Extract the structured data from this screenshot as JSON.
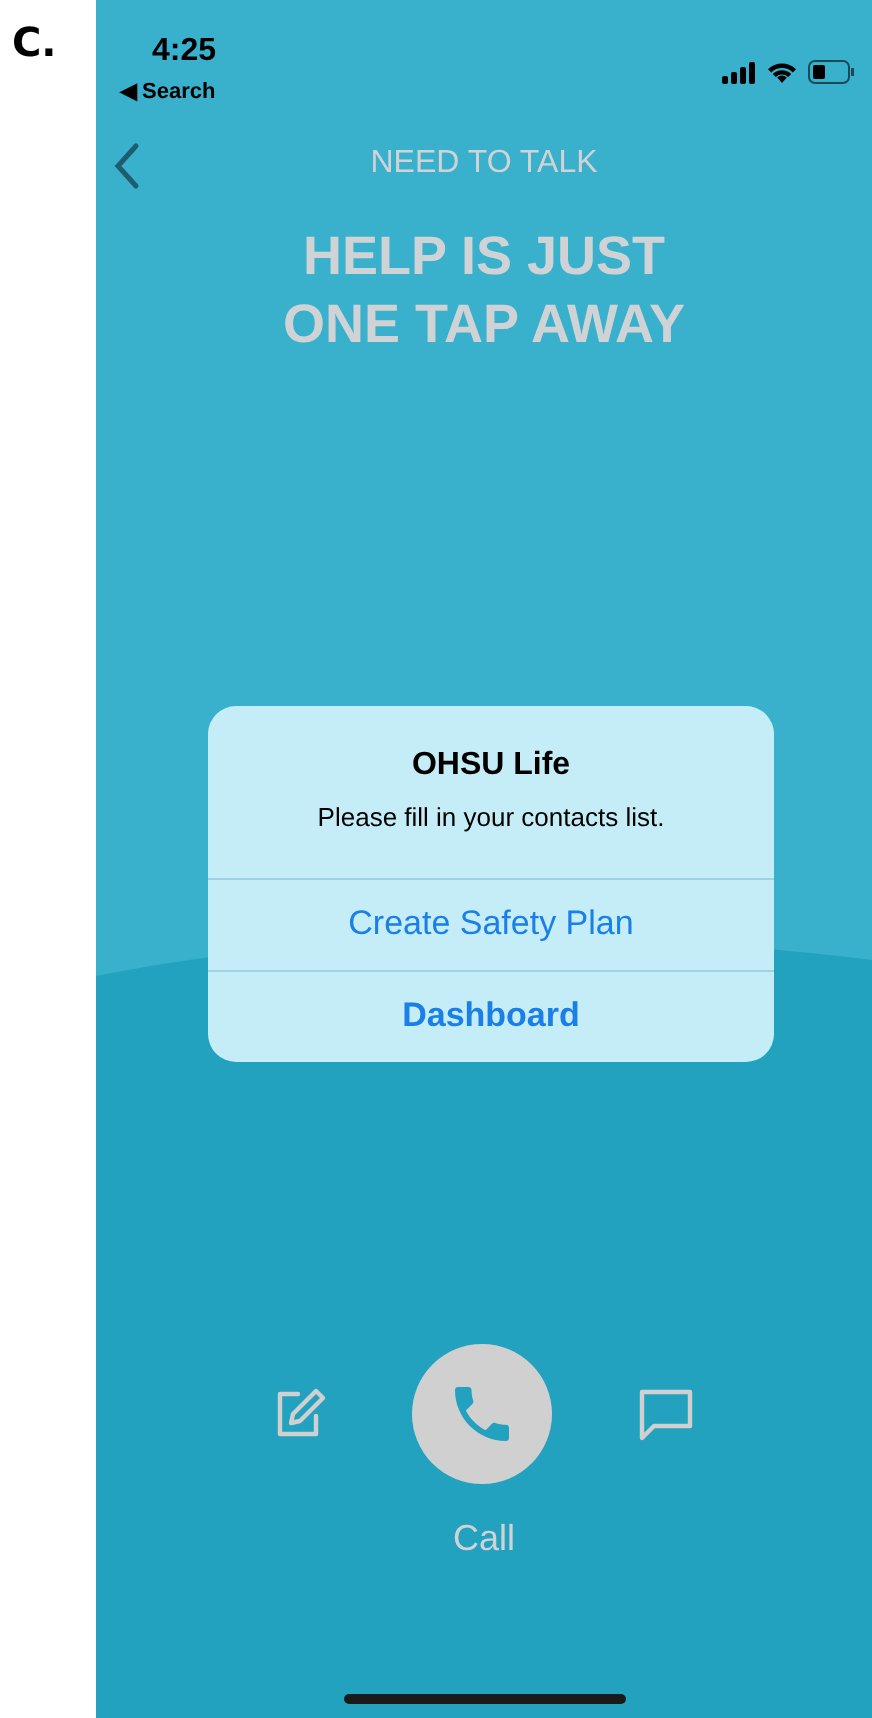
{
  "figure_label": "C.",
  "status_bar": {
    "time": "4:25",
    "back_label": "◀ Search"
  },
  "nav": {
    "title": "NEED TO TALK"
  },
  "headline": [
    "HELP IS JUST",
    "ONE TAP AWAY"
  ],
  "alert": {
    "title": "OHSU Life",
    "message": "Please fill in your contacts list.",
    "actions": [
      {
        "label": "Create Safety Plan",
        "preferred": false
      },
      {
        "label": "Dashboard",
        "preferred": true
      }
    ]
  },
  "bottom_bar": {
    "call_label": "Call"
  }
}
